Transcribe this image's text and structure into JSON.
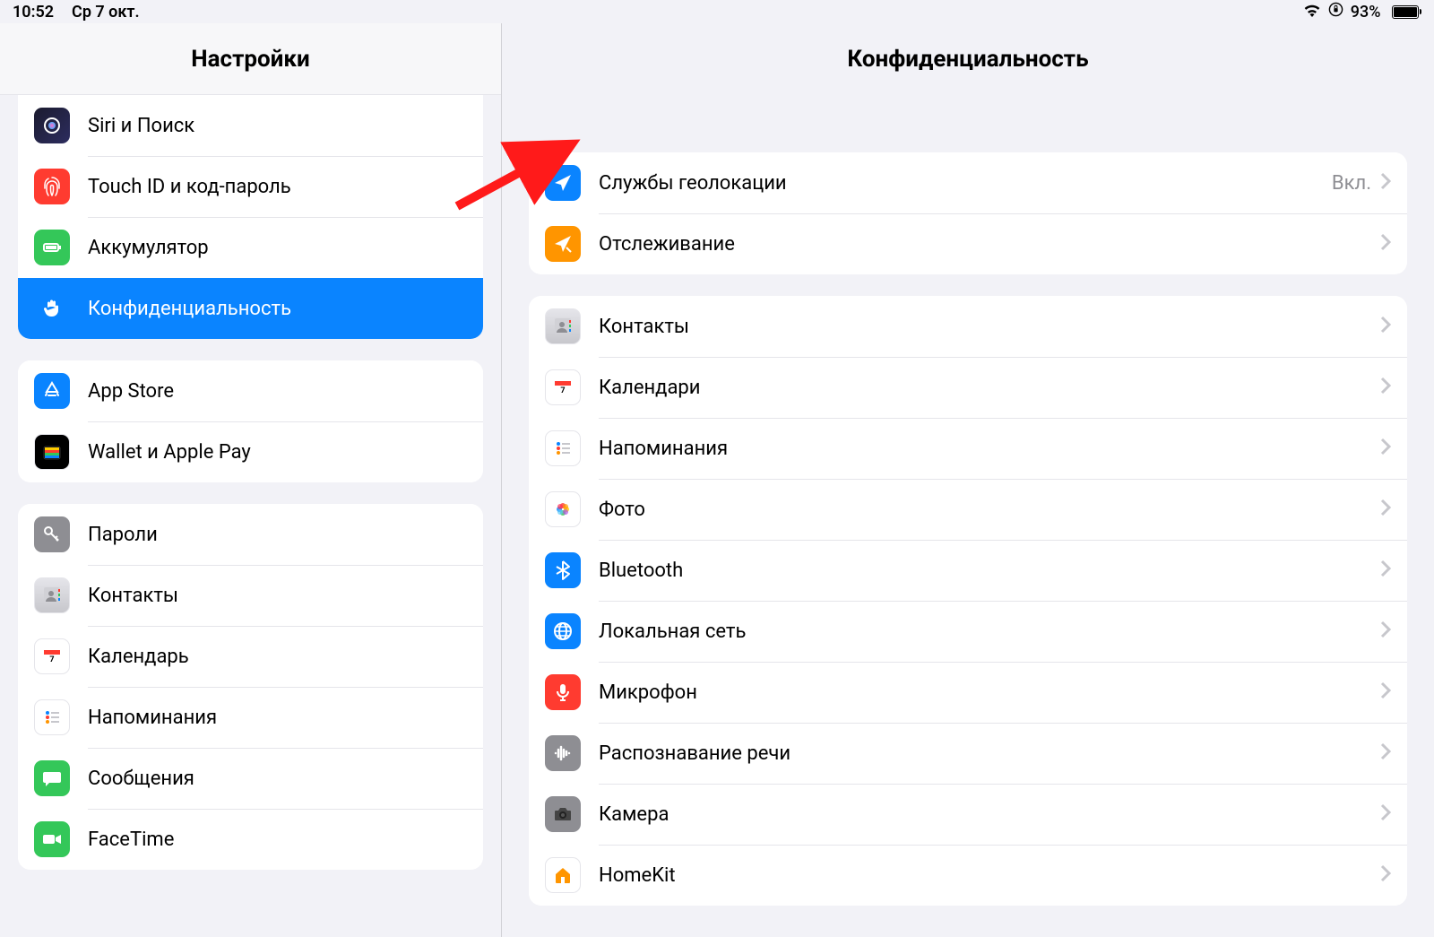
{
  "status": {
    "time": "10:52",
    "date": "Ср 7 окт.",
    "battery_pct": "93%"
  },
  "sidebar": {
    "title": "Настройки",
    "groups": [
      {
        "cls": "first-clip",
        "items": [
          {
            "id": "siri",
            "label": "Siri и Поиск",
            "icon": "siri",
            "bg": "linear-gradient(135deg,#1b1b2f 0%,#2d2d5f 100%)"
          },
          {
            "id": "touchid",
            "label": "Touch ID и код-пароль",
            "icon": "fingerprint",
            "bg": "#ff3b30"
          },
          {
            "id": "battery",
            "label": "Аккумулятор",
            "icon": "battery",
            "bg": "#34c759"
          },
          {
            "id": "privacy",
            "label": "Конфиденциальность",
            "icon": "hand",
            "bg": "#0a84ff",
            "selected": true
          }
        ]
      },
      {
        "items": [
          {
            "id": "appstore",
            "label": "App Store",
            "icon": "appstore",
            "bg": "#0a84ff"
          },
          {
            "id": "wallet",
            "label": "Wallet и Apple Pay",
            "icon": "wallet",
            "bg": "#000",
            "cls": "icon-white-card"
          }
        ]
      },
      {
        "items": [
          {
            "id": "passwords",
            "label": "Пароли",
            "icon": "key",
            "bg": "#8e8e93"
          },
          {
            "id": "contacts",
            "label": "Контакты",
            "icon": "contacts",
            "bg": "linear-gradient(#e5e5ea,#c7c7cc)",
            "cls": "icon-white-card"
          },
          {
            "id": "calendar",
            "label": "Календарь",
            "icon": "calendar",
            "bg": "#fff",
            "cls": "icon-white-card"
          },
          {
            "id": "reminders",
            "label": "Напоминания",
            "icon": "reminders",
            "bg": "#fff",
            "cls": "icon-white-card"
          },
          {
            "id": "messages",
            "label": "Сообщения",
            "icon": "messages",
            "bg": "#34c759"
          },
          {
            "id": "facetime",
            "label": "FaceTime",
            "icon": "facetime",
            "bg": "#34c759"
          }
        ]
      }
    ]
  },
  "main": {
    "title": "Конфиденциальность",
    "groups": [
      {
        "items": [
          {
            "id": "location",
            "label": "Службы геолокации",
            "value": "Вкл.",
            "icon": "location",
            "bg": "#0a84ff"
          },
          {
            "id": "tracking",
            "label": "Отслеживание",
            "icon": "tracking",
            "bg": "#ff9500"
          }
        ]
      },
      {
        "items": [
          {
            "id": "contacts2",
            "label": "Контакты",
            "icon": "contacts",
            "bg": "linear-gradient(#e5e5ea,#c7c7cc)",
            "cls": "icon-white-card"
          },
          {
            "id": "calendars2",
            "label": "Календари",
            "icon": "calendar",
            "bg": "#fff",
            "cls": "icon-white-card"
          },
          {
            "id": "reminders2",
            "label": "Напоминания",
            "icon": "reminders",
            "bg": "#fff",
            "cls": "icon-white-card"
          },
          {
            "id": "photos",
            "label": "Фото",
            "icon": "photos",
            "bg": "#fff",
            "cls": "icon-white-card"
          },
          {
            "id": "bluetooth",
            "label": "Bluetooth",
            "icon": "bluetooth",
            "bg": "#0a84ff"
          },
          {
            "id": "localnet",
            "label": "Локальная сеть",
            "icon": "globe",
            "bg": "#0a84ff"
          },
          {
            "id": "microphone",
            "label": "Микрофон",
            "icon": "mic",
            "bg": "#ff3b30"
          },
          {
            "id": "speech",
            "label": "Распознавание речи",
            "icon": "waveform",
            "bg": "#8e8e93"
          },
          {
            "id": "camera",
            "label": "Камера",
            "icon": "camera",
            "bg": "#8e8e93"
          },
          {
            "id": "homekit",
            "label": "HomeKit",
            "icon": "home",
            "bg": "#fff",
            "cls": "icon-white-card"
          }
        ]
      }
    ]
  }
}
